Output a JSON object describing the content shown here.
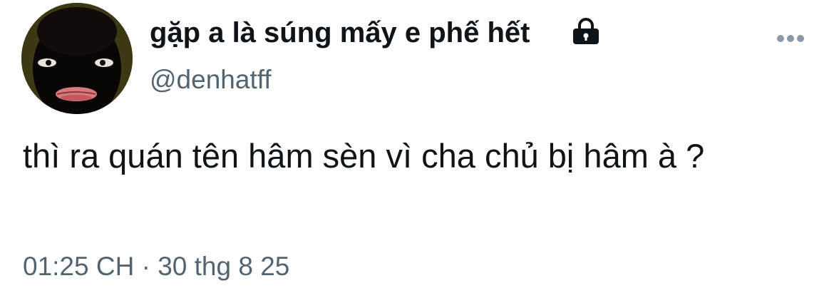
{
  "tweet": {
    "display_name": "gặp a là súng mấy e phế hết",
    "handle": "@denhatff",
    "text": "thì ra quán tên hâm sèn vì cha chủ bị hâm à ?",
    "time": "01:25 CH",
    "separator": "·",
    "date": "30 thg 8 25",
    "protected_icon": "lock-icon",
    "more_icon": "more-horizontal-icon"
  },
  "colors": {
    "text_primary": "#0f1419",
    "text_secondary": "#536471",
    "more_icon": "#8b98a5",
    "background": "#ffffff"
  }
}
